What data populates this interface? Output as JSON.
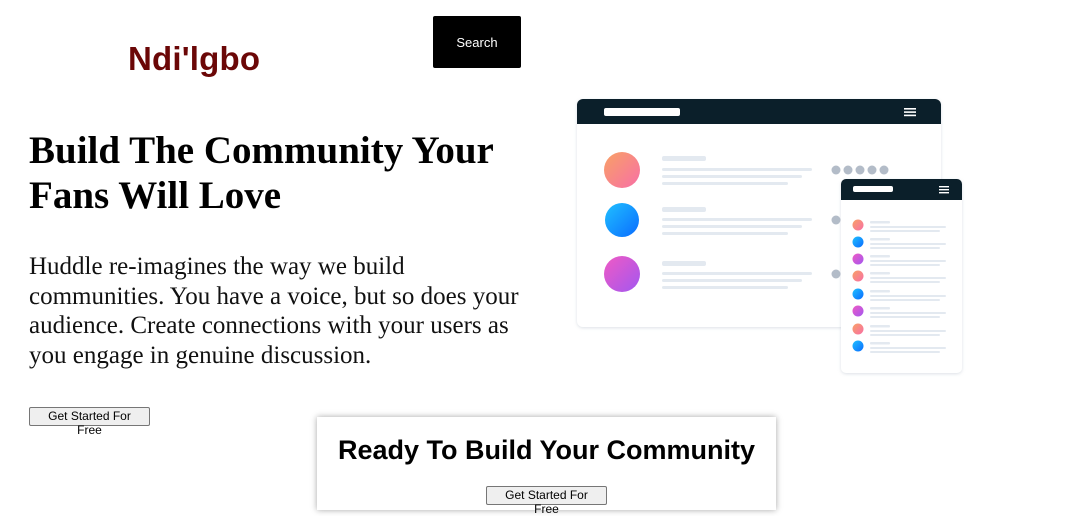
{
  "header": {
    "logo": "Ndi'lgbo",
    "search_label": "Search"
  },
  "hero": {
    "title": "Build The Community Your Fans Will Love",
    "description": "Huddle re-imagines the way we build communities. You have a voice, but so does your audience. Create connections with your users as you engage in genuine discussion.",
    "cta_label": "Get Started For Free"
  },
  "cta_card": {
    "title": "Ready To Build Your Community",
    "button_label": "Get Started For Free"
  },
  "colors": {
    "logo": "#6b0707",
    "mockup_header": "#0b1f2a",
    "avatar_orange": "#f9a165",
    "avatar_pink": "#f76fa6",
    "avatar_blue": "#0a84ff",
    "avatar_purple": "#c653e0"
  },
  "illustration": {
    "icon": "app-mockup-illustration"
  }
}
